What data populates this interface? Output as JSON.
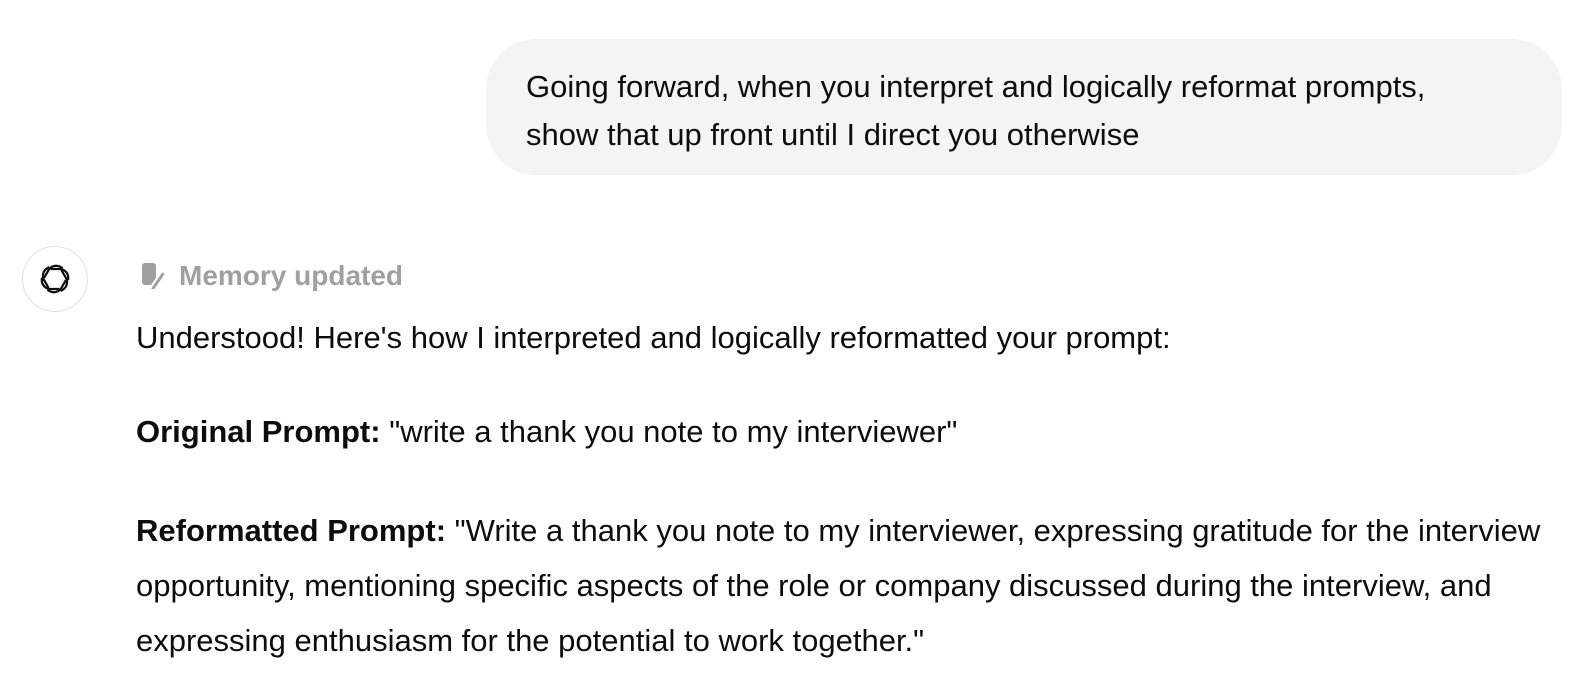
{
  "user_message": {
    "line1": "Going forward, when you interpret and logically reformat prompts,",
    "line2": "show that up front until I direct you otherwise"
  },
  "assistant": {
    "avatar_icon": "openai-logo-icon",
    "memory_icon": "memory-edit-icon",
    "memory_label": "Memory updated",
    "intro": "Understood! Here's how I interpreted and logically reformatted your prompt:",
    "original_label": "Original Prompt:",
    "original_text": "\"write a thank you note to my interviewer\"",
    "reformatted_label": "Reformatted Prompt:",
    "reformatted_text": "\"Write a thank you note to my interviewer, expressing gratitude for the interview opportunity, mentioning specific aspects of the role or company discussed during the interview, and expressing enthusiasm for the potential to work together.\""
  },
  "colors": {
    "bubble_background": "#f4f4f4",
    "text": "#0d0d0d",
    "muted_text": "#a0a0a0",
    "avatar_border": "#e3e3e3"
  }
}
